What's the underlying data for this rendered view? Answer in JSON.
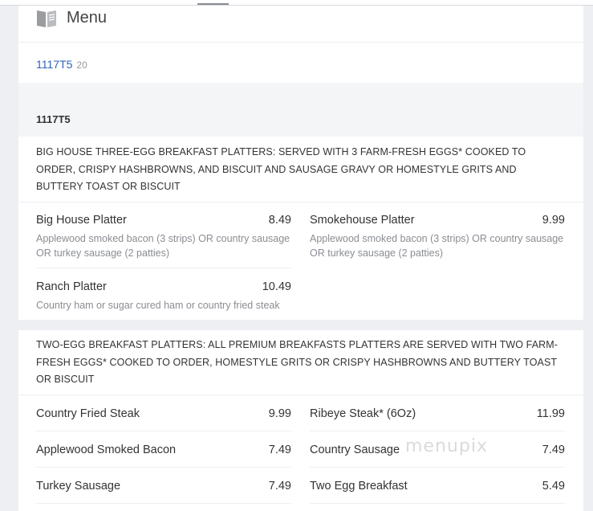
{
  "header": {
    "title": "Menu",
    "icon": "book-icon",
    "menu_link": "1117T5",
    "menu_count": "20"
  },
  "section_label": "1117T5",
  "sections": [
    {
      "description": "BIG HOUSE THREE-EGG BREAKFAST PLATTERS: SERVED WITH 3 FARM-FRESH EGGS* COOKED TO ORDER, CRISPY HASHBROWNS, AND BISCUIT AND SAUSAGE GRAVY OR HOMESTYLE GRITS AND BUTTERY TOAST OR BISCUIT",
      "items": [
        {
          "name": "Big House Platter",
          "price": "8.49",
          "description": "Applewood smoked bacon (3 strips) OR country sausage OR turkey sausage (2 patties)"
        },
        {
          "name": "Smokehouse Platter",
          "price": "9.99",
          "description": "Applewood smoked bacon (3 strips) OR country sausage OR turkey sausage (2 patties)"
        },
        {
          "name": "Ranch Platter",
          "price": "10.49",
          "description": "Country ham or sugar cured ham or country fried steak"
        }
      ]
    },
    {
      "description": "TWO-EGG BREAKFAST PLATTERS: ALL PREMIUM BREAKFASTS PLATTERS ARE SERVED WITH TWO FARM-FRESH EGGS* COOKED TO ORDER, HOMESTYLE GRITS OR CRISPY HASHBROWNS AND BUTTERY TOAST OR BISCUIT",
      "items": [
        {
          "name": "Country Fried Steak",
          "price": "9.99"
        },
        {
          "name": "Ribeye Steak* (6Oz)",
          "price": "11.99"
        },
        {
          "name": "Applewood Smoked Bacon",
          "price": "7.49"
        },
        {
          "name": "Country Sausage",
          "price": "7.49"
        },
        {
          "name": "Turkey Sausage",
          "price": "7.49"
        },
        {
          "name": "Two Egg Breakfast",
          "price": "5.49"
        }
      ]
    }
  ],
  "watermark": "menupix"
}
